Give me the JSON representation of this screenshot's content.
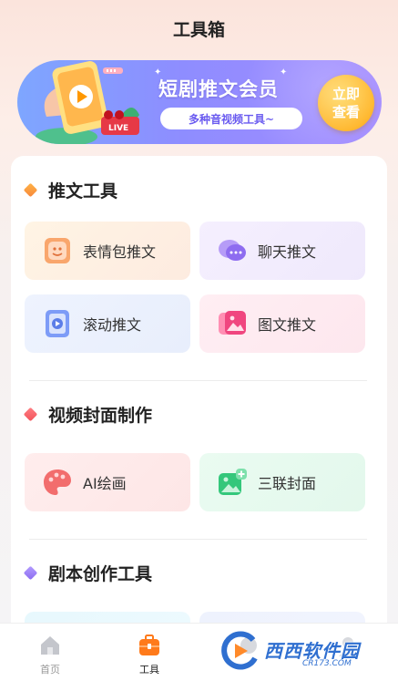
{
  "header": {
    "title": "工具箱"
  },
  "banner": {
    "title": "短剧推文会员",
    "subtitle": "多种音视频工具~",
    "cta_line1": "立即",
    "cta_line2": "查看",
    "live_badge": "LIVE"
  },
  "sections": [
    {
      "title": "推文工具",
      "color": "#f7873b",
      "items": [
        {
          "label": "表情包推文",
          "icon": "emoji-sticker-icon"
        },
        {
          "label": "聊天推文",
          "icon": "chat-bubble-icon"
        },
        {
          "label": "滚动推文",
          "icon": "scroll-video-icon"
        },
        {
          "label": "图文推文",
          "icon": "image-text-icon"
        }
      ]
    },
    {
      "title": "视频封面制作",
      "color": "#f2545b",
      "items": [
        {
          "label": "AI绘画",
          "icon": "palette-icon"
        },
        {
          "label": "三联封面",
          "icon": "image-add-icon"
        }
      ]
    },
    {
      "title": "剧本创作工具",
      "color": "#8b6cf0",
      "items": []
    }
  ],
  "tabbar": {
    "items": [
      {
        "label": "首页",
        "icon": "home-icon",
        "active": false
      },
      {
        "label": "工具",
        "icon": "toolbox-icon",
        "active": true
      },
      {
        "label": "",
        "icon": "hidden-tab-icon",
        "active": false
      },
      {
        "label": "",
        "icon": "hidden-tab-icon",
        "active": false
      }
    ]
  },
  "watermark": {
    "brand": "西西软件园",
    "url": "CR173.COM"
  }
}
